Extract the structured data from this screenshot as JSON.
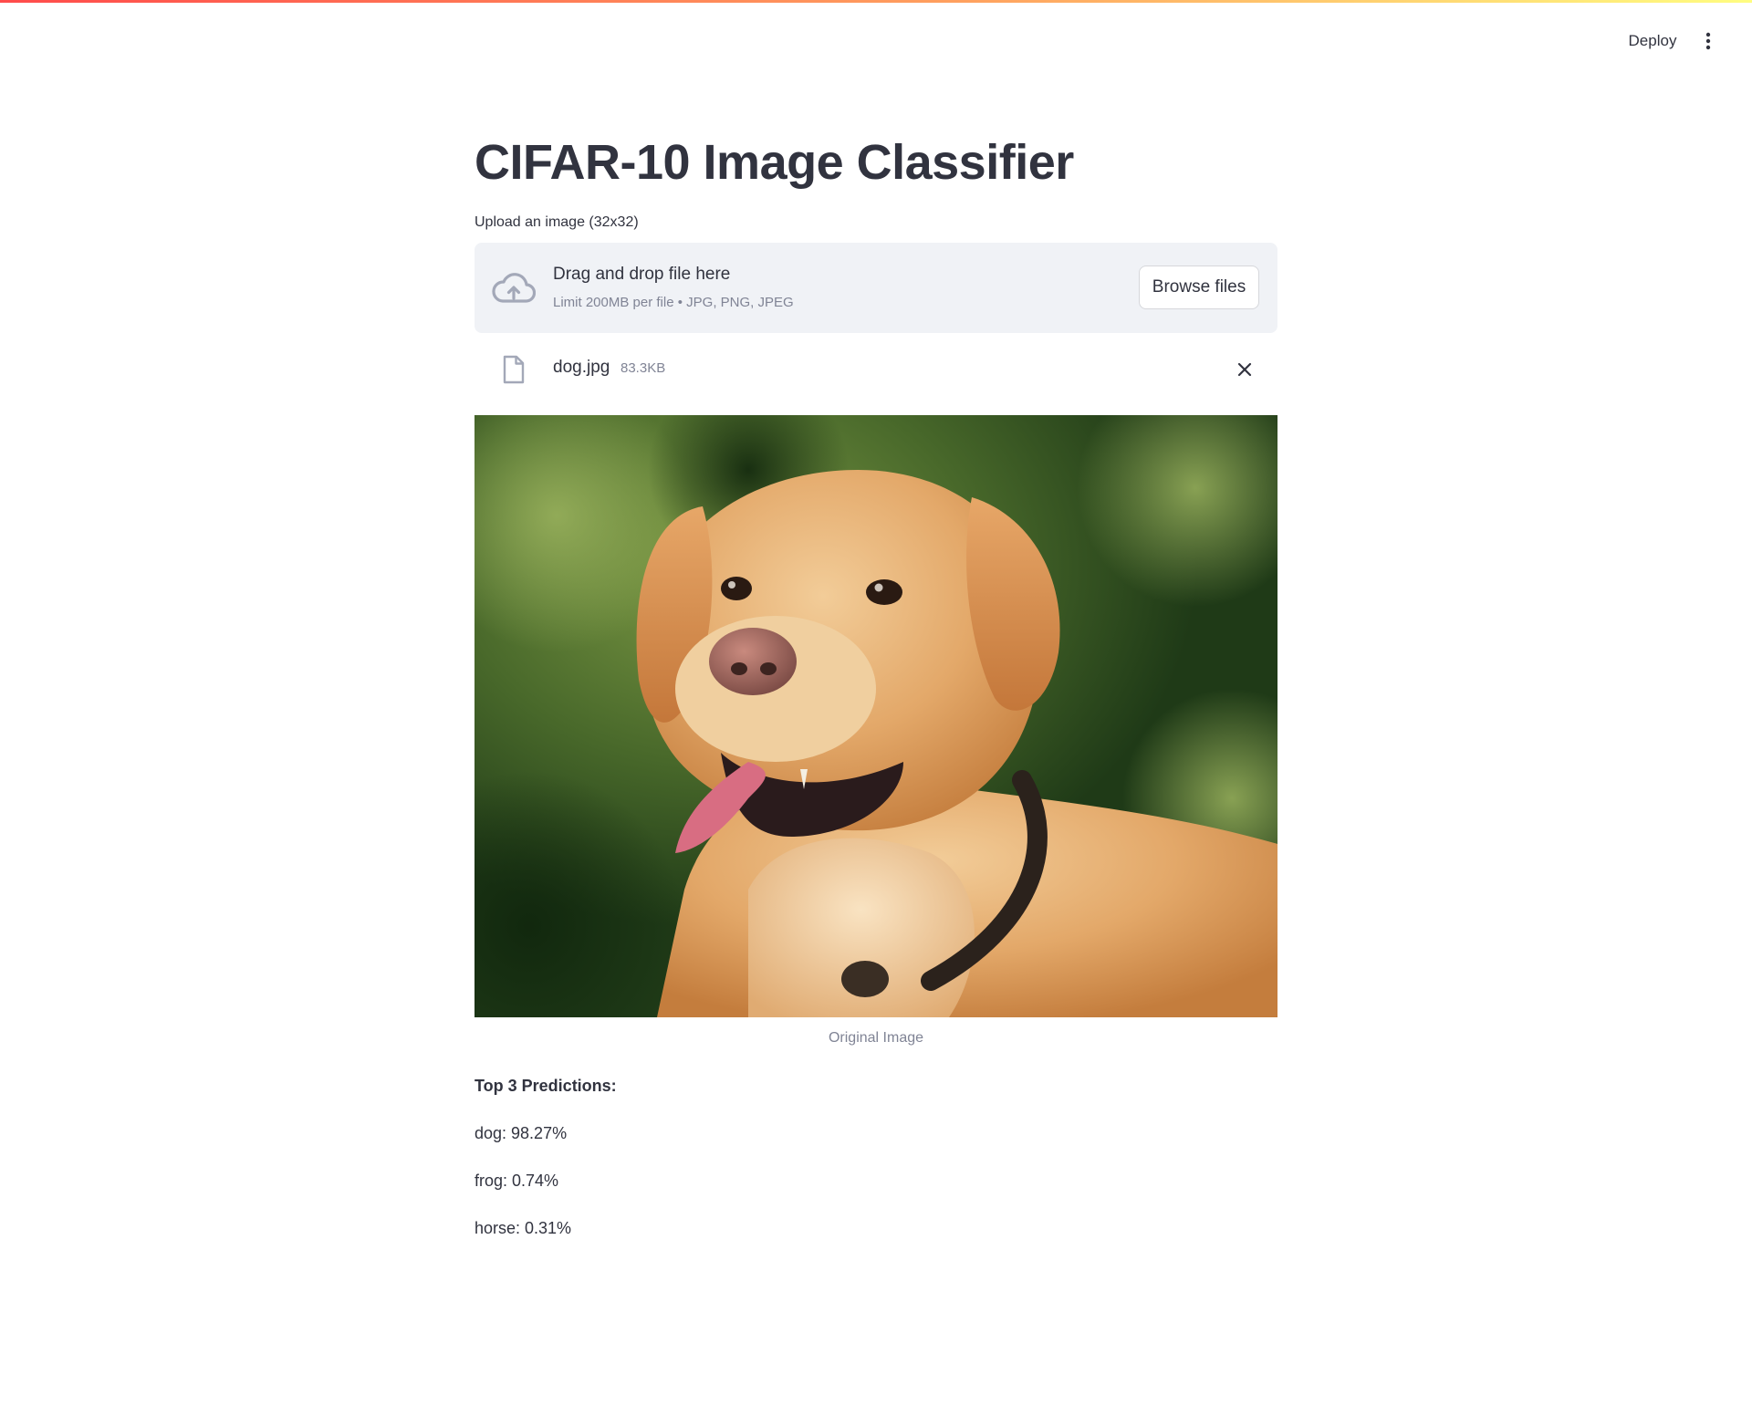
{
  "header": {
    "deploy_label": "Deploy",
    "menu_icon": "vertical-ellipsis-icon"
  },
  "main": {
    "title": "CIFAR-10 Image Classifier",
    "uploader": {
      "label": "Upload an image (32x32)",
      "drop_text": "Drag and drop file here",
      "limit_text": "Limit 200MB per file • JPG, PNG, JPEG",
      "browse_label": "Browse files",
      "icon": "cloud-upload-icon"
    },
    "uploaded_file": {
      "name": "dog.jpg",
      "size": "83.3KB",
      "icon": "file-icon",
      "remove_icon": "close-icon"
    },
    "image": {
      "subject": "golden labrador dog",
      "caption": "Original Image"
    },
    "predictions": {
      "heading": "Top 3 Predictions:",
      "items": [
        "dog: 98.27%",
        "frog: 0.74%",
        "horse: 0.31%"
      ]
    }
  },
  "colors": {
    "text": "#31333f",
    "muted": "#808495",
    "dropzone_bg": "#f0f2f6",
    "accent_gradient_start": "#ff4b4b",
    "accent_gradient_end": "#fffd80"
  }
}
